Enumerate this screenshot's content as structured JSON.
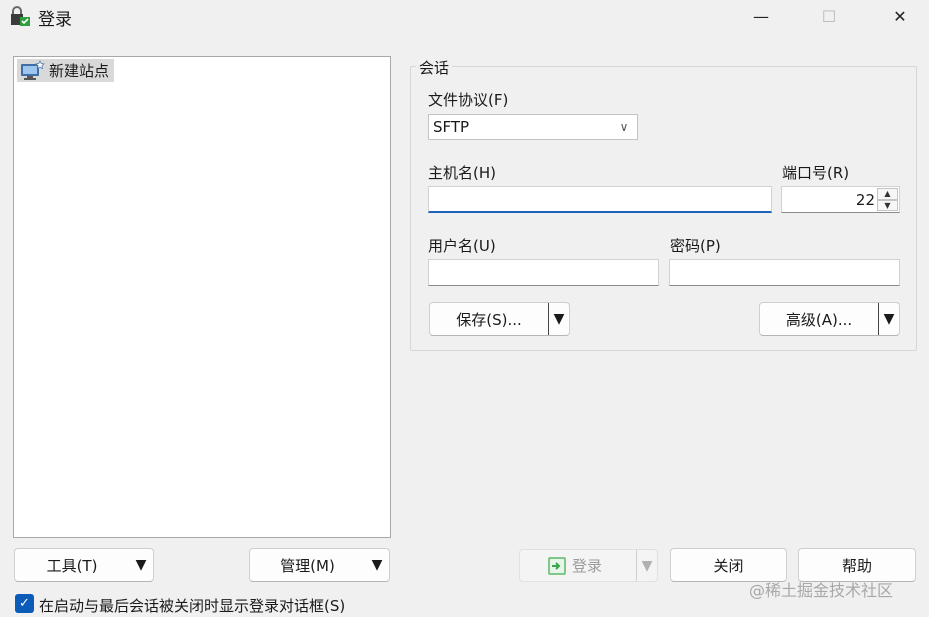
{
  "window": {
    "title": "登录",
    "minimize_glyph": "—",
    "maximize_glyph": "☐",
    "close_glyph": "✕"
  },
  "sites": {
    "items": [
      {
        "label": "新建站点",
        "icon": "monitor-new-icon",
        "selected": true
      }
    ]
  },
  "session": {
    "group_label": "会话",
    "protocol_label": "文件协议(F)",
    "protocol_value": "SFTP",
    "host_label": "主机名(H)",
    "host_value": "",
    "port_label": "端口号(R)",
    "port_value": "22",
    "user_label": "用户名(U)",
    "user_value": "",
    "password_label": "密码(P)",
    "password_value": "",
    "save_label": "保存(S)...",
    "advanced_label": "高级(A)..."
  },
  "footer": {
    "tools_label": "工具(T)",
    "manage_label": "管理(M)",
    "login_label": "登录",
    "close_label": "关闭",
    "help_label": "帮助",
    "checkbox_label": "在启动与最后会话被关闭时显示登录对话框(S)",
    "checkbox_checked": true
  },
  "watermark": "@稀土掘金技术社区",
  "colors": {
    "accent": "#1d64b8",
    "checkbox": "#0b5cb8",
    "login_icon": "#3aa64a"
  }
}
